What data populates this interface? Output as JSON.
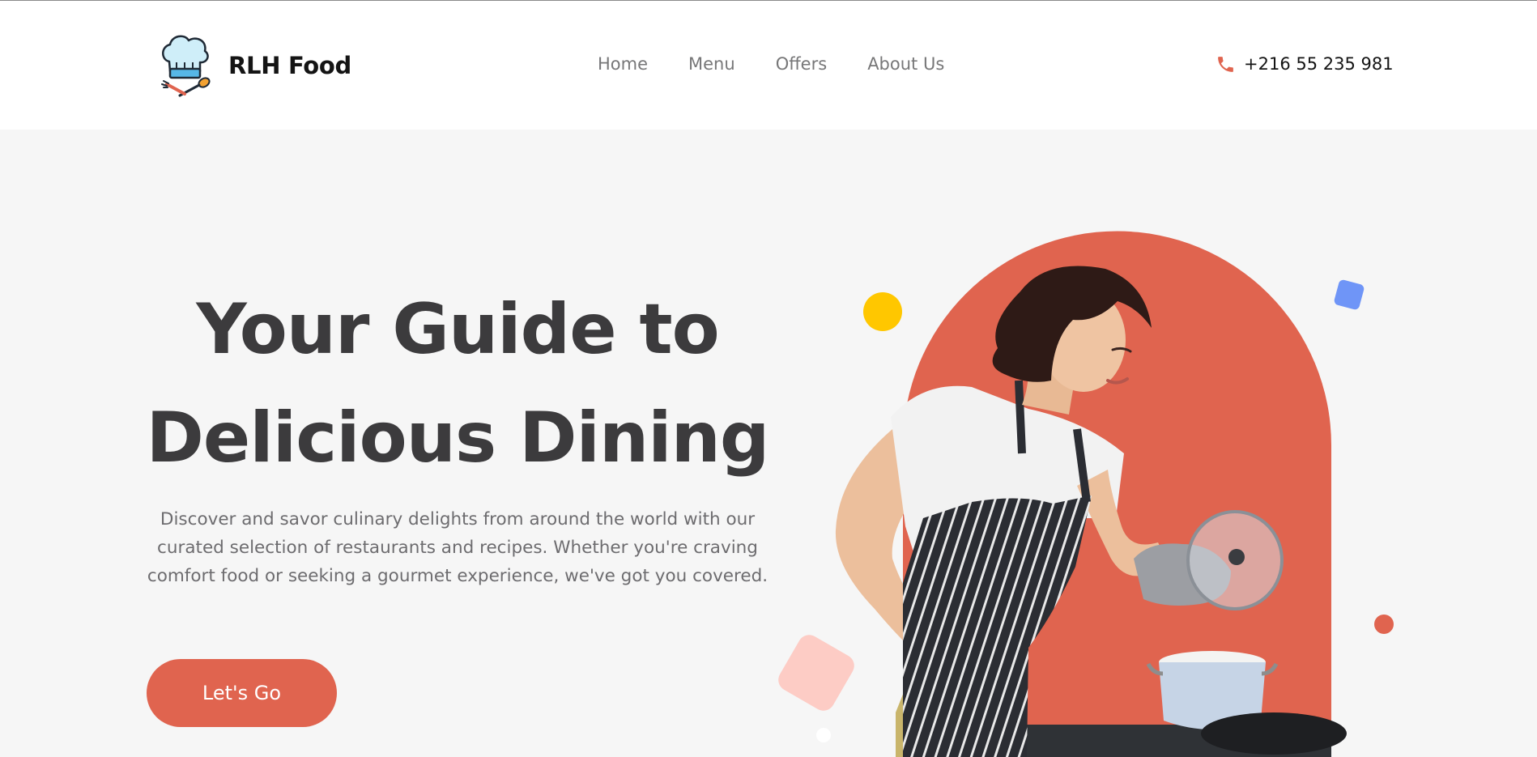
{
  "brand": {
    "name": "RLH Food",
    "logo_icon": "chef-hat-logo-icon"
  },
  "nav": {
    "items": [
      {
        "label": "Home"
      },
      {
        "label": "Menu"
      },
      {
        "label": "Offers"
      },
      {
        "label": "About Us"
      }
    ]
  },
  "contact": {
    "phone": "+216 55 235 981",
    "icon": "phone-icon"
  },
  "hero": {
    "title_line1": "Your Guide to",
    "title_line2": "Delicious Dining",
    "description": "Discover and savor culinary delights from around the world with our curated selection of restaurants and recipes. Whether you're craving comfort food or seeking a gourmet experience, we've got you covered.",
    "cta_label": "Let's Go"
  },
  "colors": {
    "accent": "#e0644f",
    "heading": "#3c3b3d",
    "body_text": "#6d6c6f",
    "nav_text": "#777778",
    "yellow_dot": "#ffc700",
    "blue_square": "#6f95f7",
    "pink_square": "#fdccc5",
    "background": "#f6f6f6",
    "header_bg": "#ffffff"
  }
}
